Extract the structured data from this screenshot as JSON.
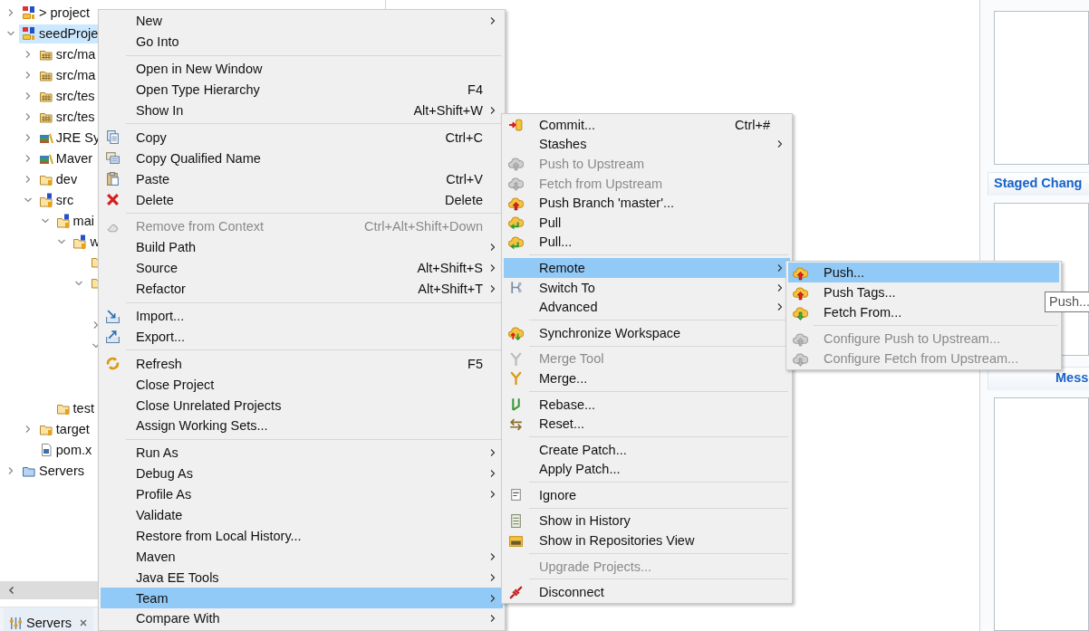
{
  "explorer": {
    "tree": [
      {
        "kind": "project",
        "label": "> project",
        "expanded": false,
        "selected": false
      },
      {
        "kind": "project",
        "label": "seedProje",
        "expanded": true,
        "selected": true,
        "children": [
          {
            "kind": "package",
            "label": "src/ma",
            "expanded": false,
            "selected": false
          },
          {
            "kind": "package",
            "label": "src/ma",
            "expanded": false,
            "selected": false
          },
          {
            "kind": "package",
            "label": "src/tes",
            "expanded": false,
            "selected": false
          },
          {
            "kind": "package",
            "label": "src/tes",
            "expanded": false,
            "selected": false
          },
          {
            "kind": "library",
            "label": "JRE Sy",
            "expanded": false,
            "selected": false
          },
          {
            "kind": "library",
            "label": "Maver",
            "expanded": false,
            "selected": false
          },
          {
            "kind": "folder",
            "label": "dev",
            "expanded": false,
            "selected": false
          },
          {
            "kind": "source",
            "label": "src",
            "expanded": true,
            "selected": false,
            "children": [
              {
                "kind": "source",
                "label": "mai",
                "expanded": true,
                "selected": false,
                "children": [
                  {
                    "kind": "source",
                    "label": "w",
                    "expanded": true,
                    "selected": false,
                    "children": [
                      {
                        "kind": "folder"
                      },
                      {
                        "kind": "folder",
                        "expanded": true,
                        "children": [
                          {
                            "expanded": false
                          },
                          {
                            "expanded": true
                          }
                        ]
                      }
                    ]
                  }
                ]
              },
              {
                "kind": "folder",
                "label": "test",
                "selected": false
              }
            ]
          },
          {
            "kind": "folder",
            "label": "target",
            "expanded": false,
            "selected": false
          },
          {
            "kind": "file",
            "label": "pom.x",
            "selected": false
          }
        ]
      },
      {
        "kind": "servers",
        "label": "Servers",
        "expanded": false,
        "selected": false
      }
    ]
  },
  "bottom_tab": {
    "label": "Servers"
  },
  "context_menu": {
    "groups": [
      [
        {
          "label": "New",
          "submenu": true,
          "disabled": false,
          "selected": false
        },
        {
          "label": "Go Into",
          "submenu": false,
          "disabled": false,
          "selected": false
        }
      ],
      [
        {
          "label": "Open in New Window",
          "submenu": false,
          "disabled": false,
          "selected": false
        },
        {
          "label": "Open Type Hierarchy",
          "shortcut": "F4",
          "submenu": false,
          "disabled": false,
          "selected": false
        },
        {
          "label": "Show In",
          "shortcut": "Alt+Shift+W",
          "submenu": true,
          "disabled": false,
          "selected": false
        }
      ],
      [
        {
          "label": "Copy",
          "shortcut": "Ctrl+C",
          "submenu": false,
          "disabled": false,
          "selected": false
        },
        {
          "label": "Copy Qualified Name",
          "submenu": false,
          "disabled": false,
          "selected": false
        },
        {
          "label": "Paste",
          "shortcut": "Ctrl+V",
          "submenu": false,
          "disabled": false,
          "selected": false
        },
        {
          "label": "Delete",
          "shortcut": "Delete",
          "submenu": false,
          "disabled": false,
          "selected": false
        }
      ],
      [
        {
          "label": "Remove from Context",
          "shortcut": "Ctrl+Alt+Shift+Down",
          "submenu": false,
          "disabled": true,
          "selected": false
        },
        {
          "label": "Build Path",
          "submenu": true,
          "disabled": false,
          "selected": false
        },
        {
          "label": "Source",
          "shortcut": "Alt+Shift+S",
          "submenu": true,
          "disabled": false,
          "selected": false
        },
        {
          "label": "Refactor",
          "shortcut": "Alt+Shift+T",
          "submenu": true,
          "disabled": false,
          "selected": false
        }
      ],
      [
        {
          "label": "Import...",
          "submenu": false,
          "disabled": false,
          "selected": false
        },
        {
          "label": "Export...",
          "submenu": false,
          "disabled": false,
          "selected": false
        }
      ],
      [
        {
          "label": "Refresh",
          "shortcut": "F5",
          "submenu": false,
          "disabled": false,
          "selected": false
        },
        {
          "label": "Close Project",
          "submenu": false,
          "disabled": false,
          "selected": false
        },
        {
          "label": "Close Unrelated Projects",
          "submenu": false,
          "disabled": false,
          "selected": false
        },
        {
          "label": "Assign Working Sets...",
          "submenu": false,
          "disabled": false,
          "selected": false
        }
      ],
      [
        {
          "label": "Run As",
          "submenu": true,
          "disabled": false,
          "selected": false
        },
        {
          "label": "Debug As",
          "submenu": true,
          "disabled": false,
          "selected": false
        },
        {
          "label": "Profile As",
          "submenu": true,
          "disabled": false,
          "selected": false
        },
        {
          "label": "Validate",
          "submenu": false,
          "disabled": false,
          "selected": false
        },
        {
          "label": "Restore from Local History...",
          "submenu": false,
          "disabled": false,
          "selected": false
        },
        {
          "label": "Maven",
          "submenu": true,
          "disabled": false,
          "selected": false
        },
        {
          "label": "Java EE Tools",
          "submenu": true,
          "disabled": false,
          "selected": false
        },
        {
          "label": "Team",
          "submenu": true,
          "disabled": false,
          "selected": true
        },
        {
          "label": "Compare With",
          "submenu": true,
          "disabled": false,
          "selected": false
        }
      ]
    ]
  },
  "team_menu": {
    "groups": [
      [
        {
          "label": "Commit...",
          "shortcut": "Ctrl+#",
          "submenu": false,
          "disabled": false,
          "selected": false
        },
        {
          "label": "Stashes",
          "submenu": true,
          "disabled": false,
          "selected": false
        },
        {
          "label": "Push to Upstream",
          "submenu": false,
          "disabled": true,
          "selected": false
        },
        {
          "label": "Fetch from Upstream",
          "submenu": false,
          "disabled": true,
          "selected": false
        },
        {
          "label": "Push Branch 'master'...",
          "submenu": false,
          "disabled": false,
          "selected": false
        },
        {
          "label": "Pull",
          "submenu": false,
          "disabled": false,
          "selected": false
        },
        {
          "label": "Pull...",
          "submenu": false,
          "disabled": false,
          "selected": false
        }
      ],
      [
        {
          "label": "Remote",
          "submenu": true,
          "disabled": false,
          "selected": true
        },
        {
          "label": "Switch To",
          "submenu": true,
          "disabled": false,
          "selected": false
        },
        {
          "label": "Advanced",
          "submenu": true,
          "disabled": false,
          "selected": false
        }
      ],
      [
        {
          "label": "Synchronize Workspace",
          "submenu": false,
          "disabled": false,
          "selected": false
        }
      ],
      [
        {
          "label": "Merge Tool",
          "submenu": false,
          "disabled": true,
          "selected": false
        },
        {
          "label": "Merge...",
          "submenu": false,
          "disabled": false,
          "selected": false
        }
      ],
      [
        {
          "label": "Rebase...",
          "submenu": false,
          "disabled": false,
          "selected": false
        },
        {
          "label": "Reset...",
          "submenu": false,
          "disabled": false,
          "selected": false
        }
      ],
      [
        {
          "label": "Create Patch...",
          "submenu": false,
          "disabled": false,
          "selected": false
        },
        {
          "label": "Apply Patch...",
          "submenu": false,
          "disabled": false,
          "selected": false
        }
      ],
      [
        {
          "label": "Ignore",
          "submenu": false,
          "disabled": false,
          "selected": false
        }
      ],
      [
        {
          "label": "Show in History",
          "submenu": false,
          "disabled": false,
          "selected": false
        },
        {
          "label": "Show in Repositories View",
          "submenu": false,
          "disabled": false,
          "selected": false
        }
      ],
      [
        {
          "label": "Upgrade Projects...",
          "submenu": false,
          "disabled": true,
          "selected": false
        }
      ],
      [
        {
          "label": "Disconnect",
          "submenu": false,
          "disabled": false,
          "selected": false
        }
      ]
    ]
  },
  "remote_menu": {
    "groups": [
      [
        {
          "label": "Push...",
          "submenu": false,
          "disabled": false,
          "selected": true
        },
        {
          "label": "Push Tags...",
          "submenu": false,
          "disabled": false,
          "selected": false
        },
        {
          "label": "Fetch From...",
          "submenu": false,
          "disabled": false,
          "selected": false
        }
      ],
      [
        {
          "label": "Configure Push to Upstream...",
          "submenu": false,
          "disabled": true,
          "selected": false
        },
        {
          "label": "Configure Fetch from Upstream...",
          "submenu": false,
          "disabled": true,
          "selected": false
        }
      ]
    ]
  },
  "tooltip": {
    "text": "Push..."
  },
  "git_panel": {
    "sections": [
      {
        "heading": "Staged Chang"
      },
      {
        "heading": "Mess"
      }
    ]
  }
}
